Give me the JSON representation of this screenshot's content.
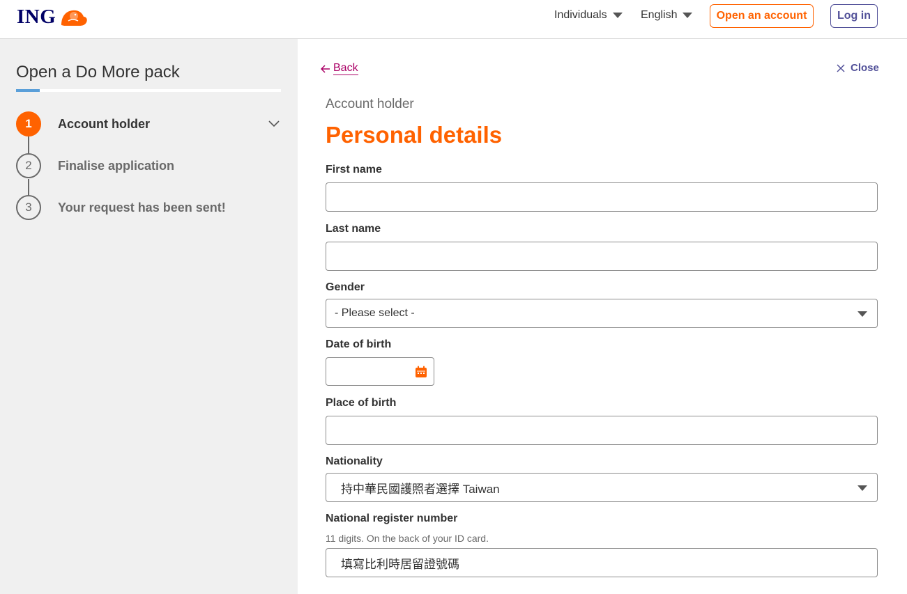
{
  "header": {
    "logo_text": "ING",
    "nav_segment": "Individuals",
    "nav_language": "English",
    "open_account_label": "Open an account",
    "login_label": "Log in",
    "brand_color": "#ff6200",
    "navy_color": "#000066"
  },
  "sidebar": {
    "title": "Open a Do More pack",
    "steps": [
      {
        "number": "1",
        "label": "Account holder",
        "active": true
      },
      {
        "number": "2",
        "label": "Finalise application",
        "active": false
      },
      {
        "number": "3",
        "label": "Your request has been sent!",
        "active": false
      }
    ]
  },
  "main": {
    "back_label": "Back",
    "close_label": "Close",
    "subheading": "Account holder",
    "heading": "Personal details",
    "fields": {
      "first_name": {
        "label": "First name",
        "value": ""
      },
      "last_name": {
        "label": "Last name",
        "value": ""
      },
      "gender": {
        "label": "Gender",
        "value": "- Please select -"
      },
      "date_of_birth": {
        "label": "Date of birth",
        "value": ""
      },
      "place_of_birth": {
        "label": "Place of birth",
        "value": ""
      },
      "nationality": {
        "label": "Nationality",
        "value": "持中華民國護照者選擇 Taiwan"
      },
      "national_register_number": {
        "label": "National register number",
        "hint": "11 digits. On the back of your ID card.",
        "value": "填寫比利時居留證號碼"
      }
    }
  }
}
